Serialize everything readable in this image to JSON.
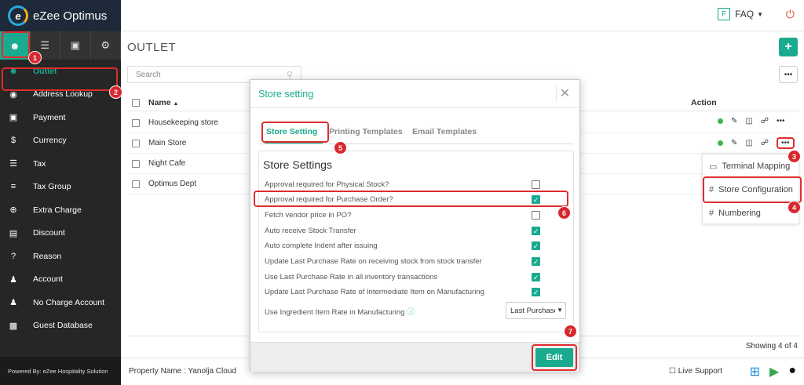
{
  "app": {
    "logo_text": "eZee Optimus",
    "powered_by": "Powered By: eZee Hospitality Solution"
  },
  "sidebar": {
    "tabs": [
      {
        "icon": "user-icon"
      },
      {
        "icon": "list-icon"
      },
      {
        "icon": "cart-icon"
      },
      {
        "icon": "gear-icon"
      }
    ],
    "items": [
      {
        "label": "Outlet",
        "icon": "user-icon"
      },
      {
        "label": "Address Lookup",
        "icon": "location-icon"
      },
      {
        "label": "Payment",
        "icon": "card-icon"
      },
      {
        "label": "Currency",
        "icon": "dollar-icon"
      },
      {
        "label": "Tax",
        "icon": "menu-icon"
      },
      {
        "label": "Tax Group",
        "icon": "list-icon"
      },
      {
        "label": "Extra Charge",
        "icon": "plus-circle-icon"
      },
      {
        "label": "Discount",
        "icon": "gift-icon"
      },
      {
        "label": "Reason",
        "icon": "question-icon"
      },
      {
        "label": "Account",
        "icon": "person-icon"
      },
      {
        "label": "No Charge Account",
        "icon": "person-icon"
      },
      {
        "label": "Guest Database",
        "icon": "database-icon"
      }
    ]
  },
  "topbar": {
    "faq_badge": "F",
    "faq_label": "FAQ"
  },
  "page": {
    "title": "OUTLET",
    "search_placeholder": "Search",
    "columns": {
      "name": "Name",
      "action": "Action"
    },
    "rows": [
      {
        "name": "Housekeeping store"
      },
      {
        "name": "Main Store"
      },
      {
        "name": "Night Cafe"
      },
      {
        "name": "Optimus Dept"
      }
    ],
    "showing": "Showing 4 of 4"
  },
  "context_menu": {
    "items": [
      {
        "label": "Terminal Mapping",
        "icon": "monitor-icon"
      },
      {
        "label": "Store Configuration",
        "icon": "hash-icon"
      },
      {
        "label": "Numbering",
        "icon": "hash-icon"
      }
    ]
  },
  "modal": {
    "title": "Store setting",
    "tabs": [
      "Store Setting",
      "Printing Templates",
      "Email Templates"
    ],
    "section_title": "Store Settings",
    "settings": [
      {
        "label": "Approval required for Physical Stock?",
        "checked": false
      },
      {
        "label": "Approval required for Purchase Order?",
        "checked": true
      },
      {
        "label": "Fetch vendor price in PO?",
        "checked": false
      },
      {
        "label": "Auto receive Stock Transfer",
        "checked": true
      },
      {
        "label": "Auto complete Indent after issuing",
        "checked": true
      },
      {
        "label": "Update Last Purchase Rate on receiving stock from stock transfer",
        "checked": true
      },
      {
        "label": "Use Last Purchase Rate in all inventory transactions",
        "checked": true
      },
      {
        "label": "Update Last Purchase Rate of Intermediate Item on Manufacturing",
        "checked": true
      }
    ],
    "ingredient_label": "Use Ingredient Item Rate in Manufacturing",
    "ingredient_value": "Last Purchase",
    "edit_label": "Edit"
  },
  "footer": {
    "property": "Property Name : Yanolja Cloud",
    "live_support": "Live Support"
  },
  "markers": [
    "1",
    "2",
    "3",
    "4",
    "5",
    "6",
    "7"
  ],
  "colors": {
    "accent": "#1aaa8f",
    "sidebar": "#262626",
    "highlight": "#e02d2d",
    "marker": "#d9272e"
  }
}
